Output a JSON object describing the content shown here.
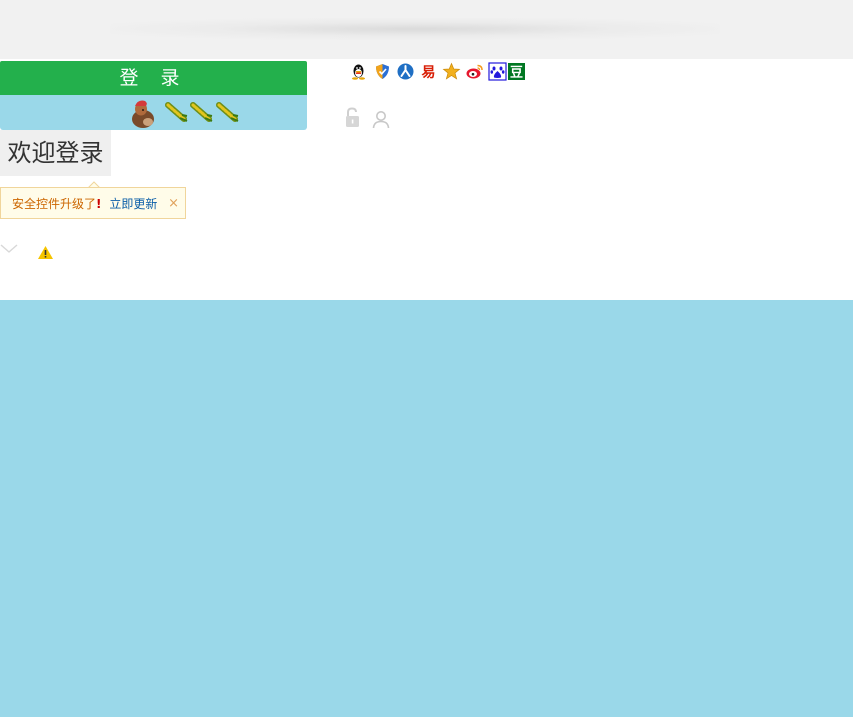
{
  "login": {
    "button_label": "登 录"
  },
  "social_login": {
    "icons": [
      {
        "name": "qq-icon",
        "color": "#000000"
      },
      {
        "name": "shield-icon",
        "color": "#2a6fd6"
      },
      {
        "name": "renren-icon",
        "color": "#1f6fc4"
      },
      {
        "name": "netease-icon",
        "color": "#d81e06"
      },
      {
        "name": "star-icon",
        "color": "#f2b01e"
      },
      {
        "name": "weibo-icon",
        "color": "#e6162d"
      },
      {
        "name": "baidu-icon",
        "color": "#2319dc"
      },
      {
        "name": "douban-icon",
        "color": "#007722"
      }
    ]
  },
  "welcome": {
    "title": "欢迎登录"
  },
  "security_notice": {
    "message": "安全控件升级了",
    "exclaim": "!",
    "link_label": "立即更新",
    "close_glyph": "×"
  },
  "colors": {
    "login_green": "#23b04c",
    "light_blue": "#9ad8e9",
    "link_blue": "#0b5ea8",
    "warning_yellow": "#f5c400"
  }
}
